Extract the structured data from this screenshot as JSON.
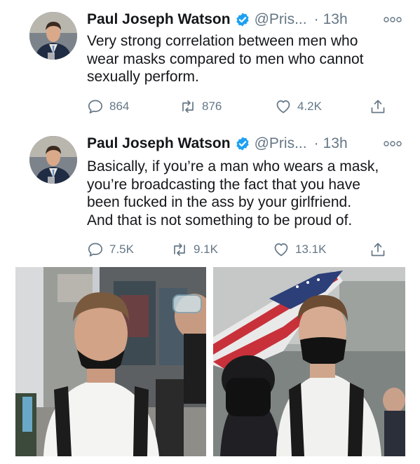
{
  "tweets": [
    {
      "author_name": "Paul Joseph Watson",
      "handle": "@Pris...",
      "separator": "·",
      "time": "13h",
      "lines": [
        "Very strong correlation between men who",
        "wear masks compared to men who cannot",
        "sexually perform."
      ],
      "replies": "864",
      "retweets": "876",
      "likes": "4.2K"
    },
    {
      "author_name": "Paul Joseph Watson",
      "handle": "@Pris...",
      "separator": "·",
      "time": "13h",
      "lines": [
        "Basically, if you’re a man who wears a mask,",
        "you’re broadcasting the fact that you have",
        "been fucked in the ass by your girlfriend.",
        "And that is not something to be proud of."
      ],
      "replies": "7.5K",
      "retweets": "9.1K",
      "likes": "13.1K"
    }
  ],
  "icons": {
    "verified": "verified-badge-icon",
    "more": "more-options-icon",
    "reply": "reply-icon",
    "retweet": "retweet-icon",
    "like": "heart-icon",
    "share": "share-icon"
  },
  "colors": {
    "verified_blue": "#1da1f2",
    "secondary_text": "#657786",
    "icon_gray": "#657786"
  }
}
